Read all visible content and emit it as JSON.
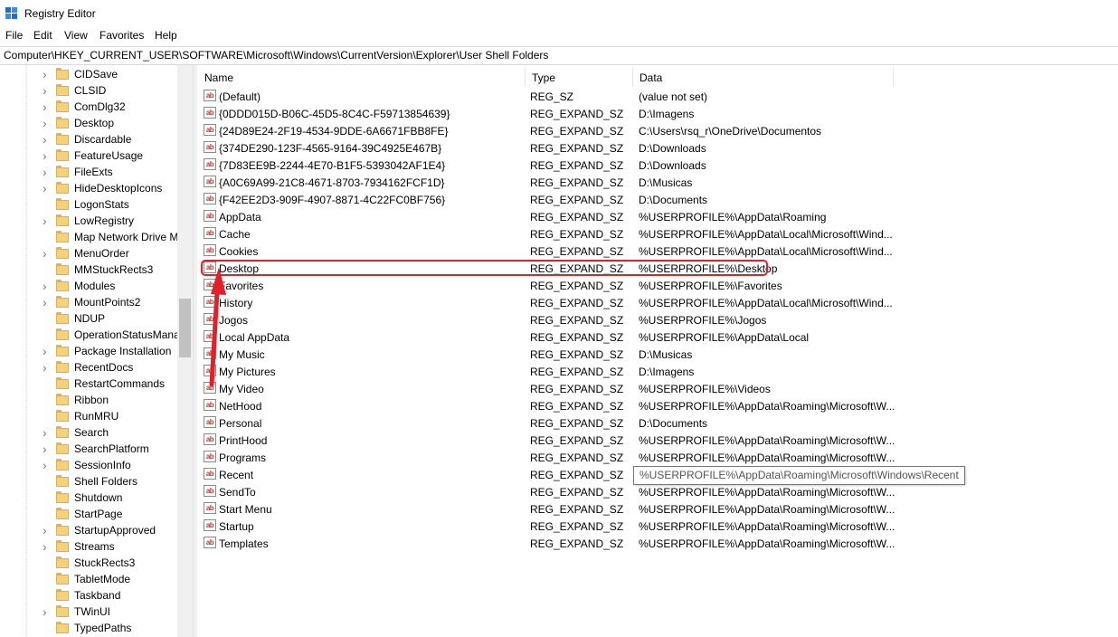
{
  "window": {
    "title": "Registry Editor"
  },
  "menu": [
    "File",
    "Edit",
    "View",
    "Favorites",
    "Help"
  ],
  "address": "Computer\\HKEY_CURRENT_USER\\SOFTWARE\\Microsoft\\Windows\\CurrentVersion\\Explorer\\User Shell Folders",
  "tree": [
    {
      "label": "CIDSave",
      "expandable": true
    },
    {
      "label": "CLSID",
      "expandable": true
    },
    {
      "label": "ComDlg32",
      "expandable": true
    },
    {
      "label": "Desktop",
      "expandable": true
    },
    {
      "label": "Discardable",
      "expandable": true
    },
    {
      "label": "FeatureUsage",
      "expandable": true
    },
    {
      "label": "FileExts",
      "expandable": true
    },
    {
      "label": "HideDesktopIcons",
      "expandable": true
    },
    {
      "label": "LogonStats",
      "expandable": false
    },
    {
      "label": "LowRegistry",
      "expandable": true
    },
    {
      "label": "Map Network Drive M",
      "expandable": false
    },
    {
      "label": "MenuOrder",
      "expandable": true
    },
    {
      "label": "MMStuckRects3",
      "expandable": false
    },
    {
      "label": "Modules",
      "expandable": true
    },
    {
      "label": "MountPoints2",
      "expandable": true
    },
    {
      "label": "NDUP",
      "expandable": false
    },
    {
      "label": "OperationStatusMana",
      "expandable": false
    },
    {
      "label": "Package Installation",
      "expandable": true
    },
    {
      "label": "RecentDocs",
      "expandable": true
    },
    {
      "label": "RestartCommands",
      "expandable": false
    },
    {
      "label": "Ribbon",
      "expandable": false
    },
    {
      "label": "RunMRU",
      "expandable": false
    },
    {
      "label": "Search",
      "expandable": true
    },
    {
      "label": "SearchPlatform",
      "expandable": true
    },
    {
      "label": "SessionInfo",
      "expandable": true
    },
    {
      "label": "Shell Folders",
      "expandable": false
    },
    {
      "label": "Shutdown",
      "expandable": false
    },
    {
      "label": "StartPage",
      "expandable": false
    },
    {
      "label": "StartupApproved",
      "expandable": true
    },
    {
      "label": "Streams",
      "expandable": true
    },
    {
      "label": "StuckRects3",
      "expandable": false
    },
    {
      "label": "TabletMode",
      "expandable": false
    },
    {
      "label": "Taskband",
      "expandable": false
    },
    {
      "label": "TWinUI",
      "expandable": true
    },
    {
      "label": "TypedPaths",
      "expandable": false
    }
  ],
  "columns": {
    "name": "Name",
    "type": "Type",
    "data": "Data"
  },
  "icon_text": "ab",
  "values": [
    {
      "name": "(Default)",
      "type": "REG_SZ",
      "data": "(value not set)"
    },
    {
      "name": "{0DDD015D-B06C-45D5-8C4C-F59713854639}",
      "type": "REG_EXPAND_SZ",
      "data": "D:\\Imagens"
    },
    {
      "name": "{24D89E24-2F19-4534-9DDE-6A6671FBB8FE}",
      "type": "REG_EXPAND_SZ",
      "data": "C:\\Users\\rsq_r\\OneDrive\\Documentos"
    },
    {
      "name": "{374DE290-123F-4565-9164-39C4925E467B}",
      "type": "REG_EXPAND_SZ",
      "data": "D:\\Downloads"
    },
    {
      "name": "{7D83EE9B-2244-4E70-B1F5-5393042AF1E4}",
      "type": "REG_EXPAND_SZ",
      "data": "D:\\Downloads"
    },
    {
      "name": "{A0C69A99-21C8-4671-8703-7934162FCF1D}",
      "type": "REG_EXPAND_SZ",
      "data": "D:\\Musicas"
    },
    {
      "name": "{F42EE2D3-909F-4907-8871-4C22FC0BF756}",
      "type": "REG_EXPAND_SZ",
      "data": "D:\\Documents"
    },
    {
      "name": "AppData",
      "type": "REG_EXPAND_SZ",
      "data": "%USERPROFILE%\\AppData\\Roaming"
    },
    {
      "name": "Cache",
      "type": "REG_EXPAND_SZ",
      "data": "%USERPROFILE%\\AppData\\Local\\Microsoft\\Wind..."
    },
    {
      "name": "Cookies",
      "type": "REG_EXPAND_SZ",
      "data": "%USERPROFILE%\\AppData\\Local\\Microsoft\\Wind..."
    },
    {
      "name": "Desktop",
      "type": "REG_EXPAND_SZ",
      "data": "%USERPROFILE%\\Desktop"
    },
    {
      "name": "Favorites",
      "type": "REG_EXPAND_SZ",
      "data": "%USERPROFILE%\\Favorites"
    },
    {
      "name": "History",
      "type": "REG_EXPAND_SZ",
      "data": "%USERPROFILE%\\AppData\\Local\\Microsoft\\Wind..."
    },
    {
      "name": "Jogos",
      "type": "REG_EXPAND_SZ",
      "data": "%USERPROFILE%\\Jogos"
    },
    {
      "name": "Local AppData",
      "type": "REG_EXPAND_SZ",
      "data": "%USERPROFILE%\\AppData\\Local"
    },
    {
      "name": "My Music",
      "type": "REG_EXPAND_SZ",
      "data": "D:\\Musicas"
    },
    {
      "name": "My Pictures",
      "type": "REG_EXPAND_SZ",
      "data": "D:\\Imagens"
    },
    {
      "name": "My Video",
      "type": "REG_EXPAND_SZ",
      "data": "%USERPROFILE%\\Videos"
    },
    {
      "name": "NetHood",
      "type": "REG_EXPAND_SZ",
      "data": "%USERPROFILE%\\AppData\\Roaming\\Microsoft\\W..."
    },
    {
      "name": "Personal",
      "type": "REG_EXPAND_SZ",
      "data": "D:\\Documents"
    },
    {
      "name": "PrintHood",
      "type": "REG_EXPAND_SZ",
      "data": "%USERPROFILE%\\AppData\\Roaming\\Microsoft\\W..."
    },
    {
      "name": "Programs",
      "type": "REG_EXPAND_SZ",
      "data": "%USERPROFILE%\\AppData\\Roaming\\Microsoft\\W..."
    },
    {
      "name": "Recent",
      "type": "REG_EXPAND_SZ",
      "data": "%USERPROFILE%\\AppData\\Roaming\\Microsoft\\W..."
    },
    {
      "name": "SendTo",
      "type": "REG_EXPAND_SZ",
      "data": "%USERPROFILE%\\AppData\\Roaming\\Microsoft\\W..."
    },
    {
      "name": "Start Menu",
      "type": "REG_EXPAND_SZ",
      "data": "%USERPROFILE%\\AppData\\Roaming\\Microsoft\\W..."
    },
    {
      "name": "Startup",
      "type": "REG_EXPAND_SZ",
      "data": "%USERPROFILE%\\AppData\\Roaming\\Microsoft\\W..."
    },
    {
      "name": "Templates",
      "type": "REG_EXPAND_SZ",
      "data": "%USERPROFILE%\\AppData\\Roaming\\Microsoft\\W..."
    }
  ],
  "tooltip": "%USERPROFILE%\\AppData\\Roaming\\Microsoft\\Windows\\Recent",
  "annotation_color": "#e0202a"
}
